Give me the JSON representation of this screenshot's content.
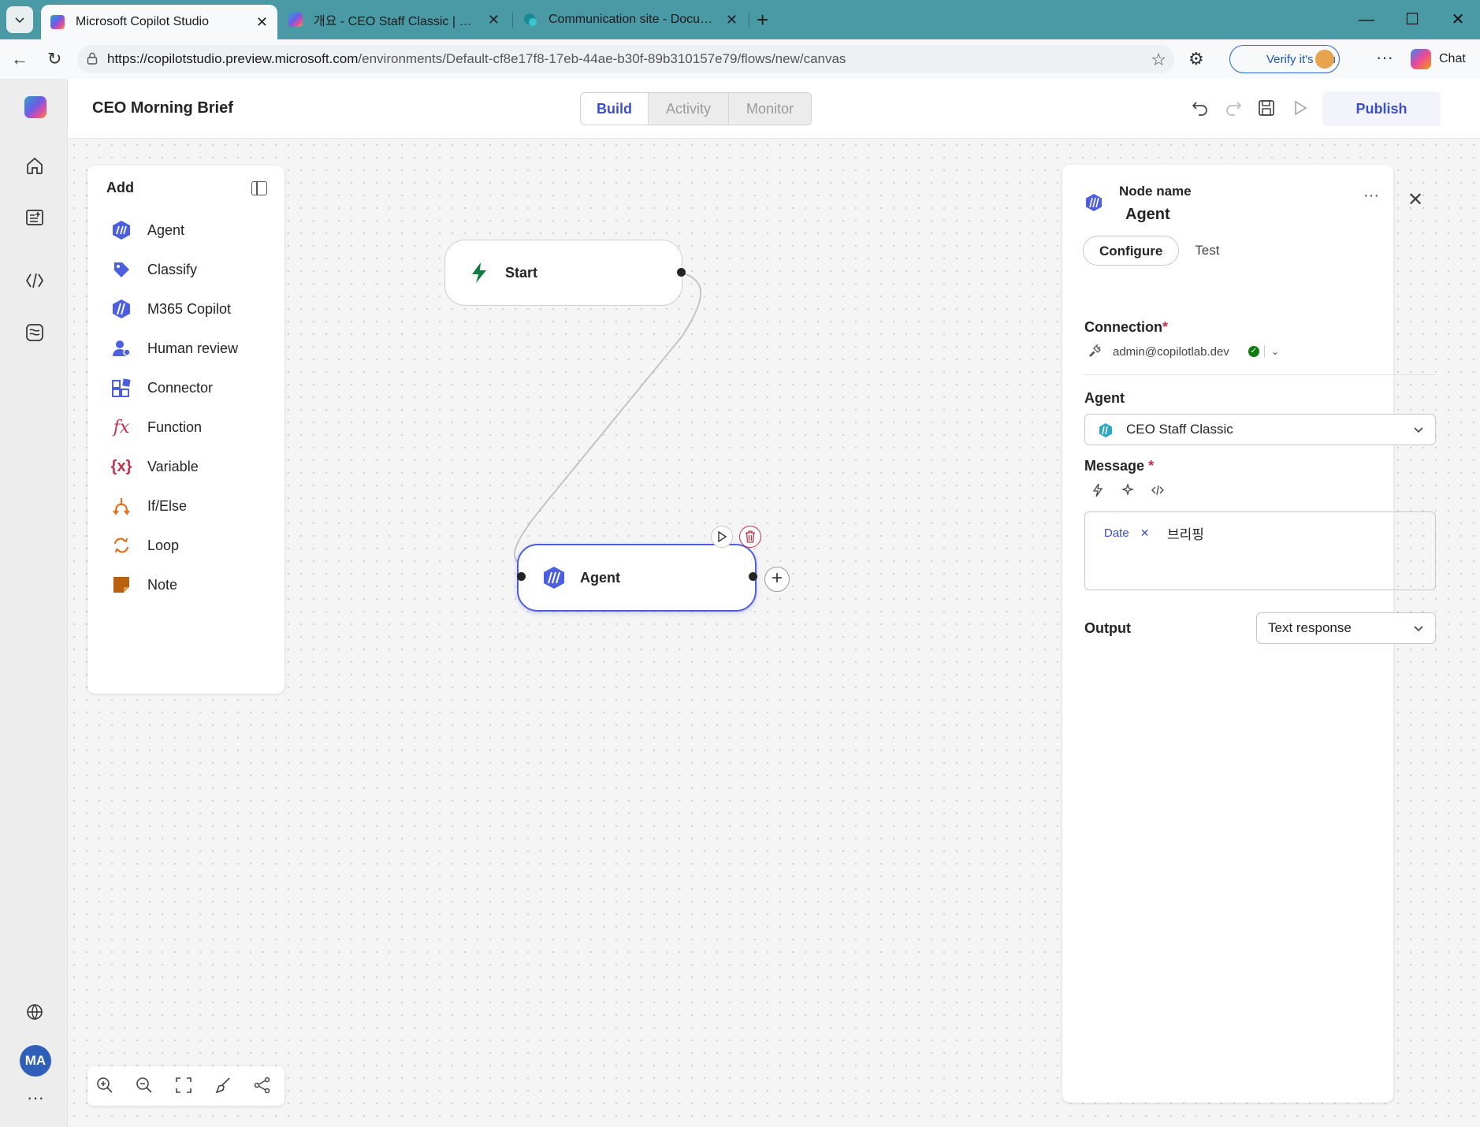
{
  "browser": {
    "tabs": [
      {
        "title": "Microsoft Copilot Studio",
        "active": true
      },
      {
        "title": "개요 - CEO Staff Classic | Microsoft",
        "active": false
      },
      {
        "title": "Communication site - Documents",
        "active": false
      }
    ],
    "url_host": "https://copilotstudio.preview.microsoft.com",
    "url_path": "/environments/Default-cf8e17f8-17eb-44ae-b30f-89b310157e79/flows/new/canvas",
    "verify_label": "Verify it's you",
    "chat_label": "Chat"
  },
  "app": {
    "flow_title": "CEO Morning Brief",
    "modes": {
      "build": "Build",
      "activity": "Activity",
      "monitor": "Monitor"
    },
    "publish_label": "Publish",
    "user_initials": "MA"
  },
  "add_panel": {
    "title": "Add",
    "items": [
      {
        "label": "Agent",
        "icon": "agent-icon"
      },
      {
        "label": "Classify",
        "icon": "tag-icon"
      },
      {
        "label": "M365 Copilot",
        "icon": "m365-copilot-icon"
      },
      {
        "label": "Human review",
        "icon": "person-icon"
      },
      {
        "label": "Connector",
        "icon": "connector-icon"
      },
      {
        "label": "Function",
        "icon": "function-icon"
      },
      {
        "label": "Variable",
        "icon": "variable-icon"
      },
      {
        "label": "If/Else",
        "icon": "branch-icon"
      },
      {
        "label": "Loop",
        "icon": "loop-icon"
      },
      {
        "label": "Note",
        "icon": "note-icon"
      }
    ]
  },
  "canvas": {
    "start_node": "Start",
    "agent_node": "Agent"
  },
  "properties": {
    "node_name_label": "Node name",
    "node_name": "Agent",
    "tabs": {
      "configure": "Configure",
      "test": "Test"
    },
    "connection_label": "Connection",
    "connection_account": "admin@copilotlab.dev",
    "agent_label": "Agent",
    "agent_value": "CEO Staff Classic",
    "message_label": "Message",
    "message_chip": "Date",
    "message_text": "브리핑",
    "output_label": "Output",
    "output_value": "Text response"
  },
  "colors": {
    "accent": "#3b50c8",
    "browser_frame": "#4a9aa5",
    "required": "#c4314b",
    "connected": "#107c10"
  }
}
